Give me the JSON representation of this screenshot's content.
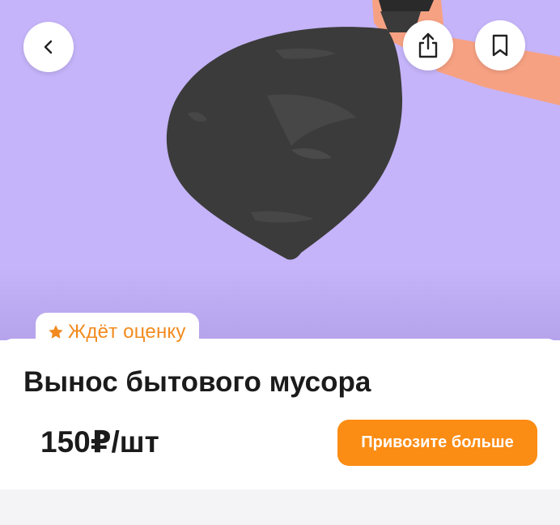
{
  "hero": {
    "background_color": "#c5b4f9",
    "illustration": "trash-bag-in-hand"
  },
  "toolbar": {
    "back_icon": "chevron-left-icon",
    "share_icon": "share-icon",
    "bookmark_icon": "bookmark-icon"
  },
  "badge": {
    "icon": "star-icon",
    "label": "Ждёт оценку",
    "color": "#f28a1e"
  },
  "service": {
    "title": "Вынос бытового мусора",
    "price": "150₽/шт"
  },
  "cta": {
    "label": "Привозите больше",
    "color": "#fb8c14"
  }
}
